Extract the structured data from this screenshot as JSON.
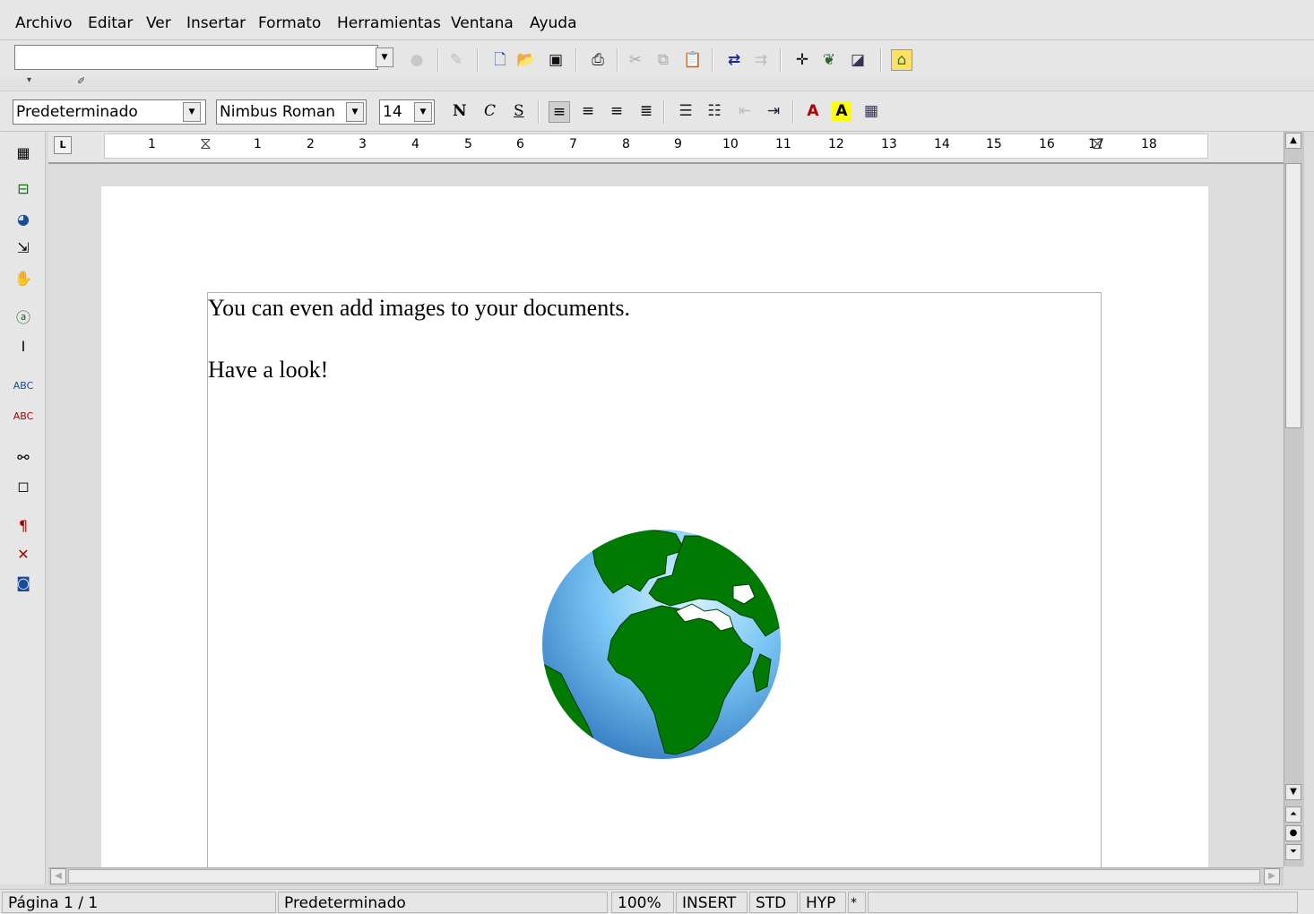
{
  "menu": [
    "Archivo",
    "Editar",
    "Ver",
    "Insertar",
    "Formato",
    "Herramientas",
    "Ventana",
    "Ayuda"
  ],
  "toolbar": {
    "url_value": "",
    "icons": [
      "load-url-icon",
      "edit-file-icon",
      "new-document-icon",
      "open-icon",
      "save-icon",
      "print-icon",
      "cut-icon",
      "copy-icon",
      "paste-icon",
      "undo-icon",
      "redo-icon",
      "navigator-icon",
      "stylist-icon",
      "gallery-icon",
      "show-draw-functions-icon"
    ]
  },
  "format": {
    "style": "Predeterminado",
    "font": "Nimbus Roman",
    "size": "14",
    "bold": "N",
    "italic": "C",
    "underline": "S"
  },
  "ruler": {
    "tab_marker": "L",
    "labels": [
      "1",
      "1",
      "2",
      "3",
      "4",
      "5",
      "6",
      "7",
      "8",
      "9",
      "10",
      "11",
      "12",
      "13",
      "14",
      "15",
      "16",
      "17",
      "18"
    ]
  },
  "document": {
    "line1": "You can even add images to your documents.",
    "line2": "Have a look!"
  },
  "status": {
    "page": "Página  1 / 1",
    "style": "Predeterminado",
    "zoom": "100%",
    "insert": "INSERT",
    "std": "STD",
    "hyp": "HYP",
    "modified": "*"
  },
  "colors": {
    "font_color": "#aa0000",
    "highlight": "#ffff00",
    "globe_land": "#007a00",
    "globe_sea": "#79c6f5"
  }
}
